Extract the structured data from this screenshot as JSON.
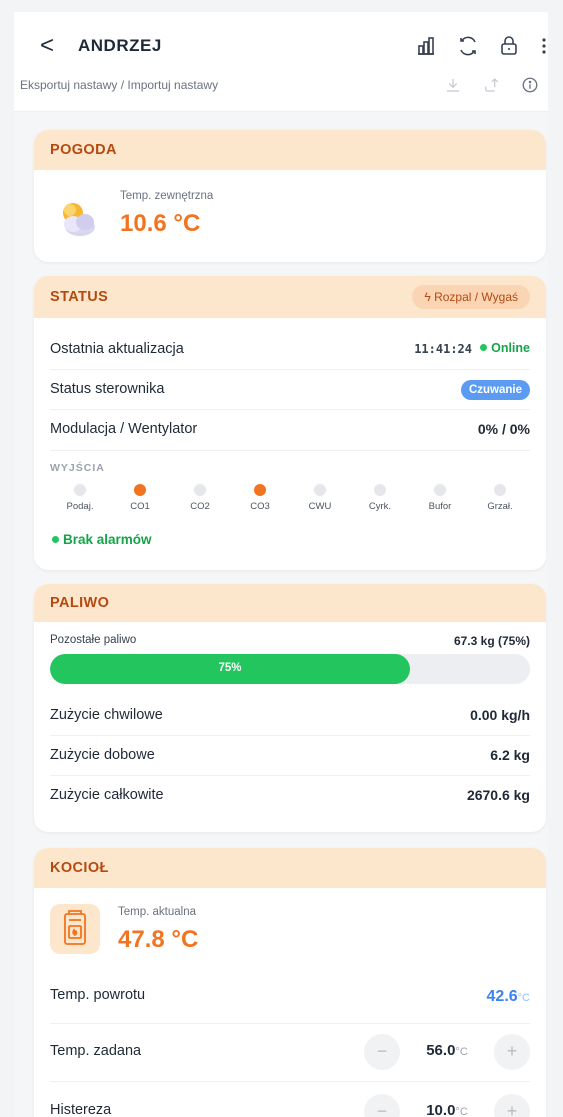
{
  "header": {
    "back_glyph": "<",
    "title": "ANDRZEJ",
    "icons": [
      "chart-icon",
      "refresh-icon",
      "lock-icon",
      "more-icon"
    ],
    "subtitle": "Eksportuj nastawy / Importuj nastawy",
    "sub_icons": [
      "download-icon",
      "upload-icon",
      "info-icon"
    ]
  },
  "weather": {
    "title": "POGODA",
    "label": "Temp. zewnętrzna",
    "value": "10.6 °C"
  },
  "status": {
    "title": "STATUS",
    "action_label": "Rozpal / Wygaś",
    "last_update_label": "Ostatnia aktualizacja",
    "time": "11:41:24",
    "online": "Online",
    "controller_label": "Status sterownika",
    "controller_value": "Czuwanie",
    "modulation_label": "Modulacja / Wentylator",
    "modulation_value": "0% / 0%",
    "outputs_title": "WYJŚCIA",
    "outputs": [
      {
        "label": "Podaj.",
        "on": false
      },
      {
        "label": "CO1",
        "on": true
      },
      {
        "label": "CO2",
        "on": false
      },
      {
        "label": "CO3",
        "on": true
      },
      {
        "label": "CWU",
        "on": false
      },
      {
        "label": "Cyrk.",
        "on": false
      },
      {
        "label": "Bufor",
        "on": false
      },
      {
        "label": "Grzał.",
        "on": false
      }
    ],
    "alarm_text": "Brak alarmów"
  },
  "fuel": {
    "title": "PALIWO",
    "remaining_label": "Pozostałe paliwo",
    "remaining_value": "67.3 kg (75%)",
    "level_percent": 75,
    "bar_text": "75%",
    "rows": [
      {
        "label": "Zużycie chwilowe",
        "value": "0.00 kg/h"
      },
      {
        "label": "Zużycie dobowe",
        "value": "6.2 kg"
      },
      {
        "label": "Zużycie całkowite",
        "value": "2670.6 kg"
      }
    ]
  },
  "boiler": {
    "title": "KOCIOŁ",
    "current_label": "Temp. aktualna",
    "current_value": "47.8 °C",
    "return_label": "Temp. powrotu",
    "return_value": "42.6",
    "return_unit": "°C",
    "setpoint_label": "Temp. zadana",
    "setpoint_value": "56.0",
    "hysteresis_label": "Histereza",
    "hysteresis_value": "10.0",
    "unit": "°C",
    "minus": "−",
    "plus": "+"
  },
  "colors": {
    "accent": "#f27420",
    "card_header": "#fde7cc",
    "title_color": "#b44a12",
    "ok_green": "#22c55e",
    "info_blue": "#3b82f6"
  }
}
